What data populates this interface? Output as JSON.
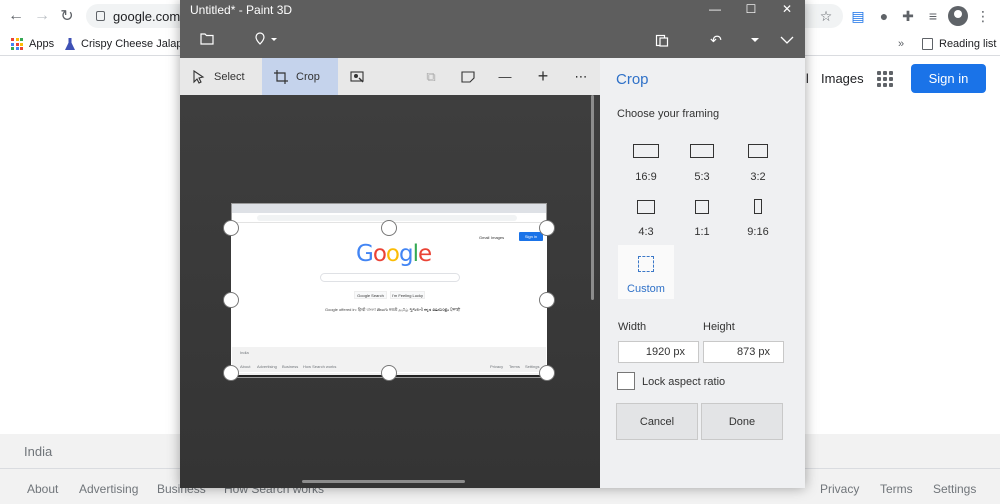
{
  "chrome": {
    "url": "google.com",
    "bookmarks": [
      {
        "label": "Apps"
      },
      {
        "label": "Crispy Cheese Jalap..."
      }
    ],
    "bookmarks_more": "»",
    "reading_list": "Reading list"
  },
  "google": {
    "links": {
      "gmail_partial": "il",
      "images": "Images"
    },
    "sign_in": "Sign in",
    "footer": {
      "country": "India",
      "left_links": [
        "About",
        "Advertising",
        "Business",
        "How Search works"
      ],
      "right_links": [
        "Privacy",
        "Terms",
        "Settings"
      ]
    }
  },
  "paint3d": {
    "title": "Untitled* - Paint 3D",
    "tools": {
      "select": "Select",
      "crop": "Crop"
    },
    "canvas_preview": {
      "logo": "Google",
      "links": [
        "Gmail",
        "Images"
      ],
      "sign_in": "Sign in",
      "buttons": [
        "Google Search",
        "I'm Feeling Lucky"
      ],
      "offered_in": "Google offered in: हिन्दी বাংলা తెలుగు मराठी தமிழ் ગુજરાતી ಕನ್ನಡ മലയാളം ਪੰਜਾਬੀ",
      "footer_country": "India",
      "footer_left": [
        "About",
        "Advertising",
        "Business",
        "How Search works"
      ],
      "footer_right": [
        "Privacy",
        "Terms",
        "Settings"
      ]
    },
    "panel": {
      "title": "Crop",
      "subtitle": "Choose your framing",
      "framings": [
        "16:9",
        "5:3",
        "3:2",
        "4:3",
        "1:1",
        "9:16",
        "Custom"
      ],
      "selected_framing": "Custom",
      "width_label": "Width",
      "height_label": "Height",
      "width_value": "1920 px",
      "height_value": "873 px",
      "lock_label": "Lock aspect ratio",
      "lock_checked": false,
      "cancel": "Cancel",
      "done": "Done"
    }
  }
}
